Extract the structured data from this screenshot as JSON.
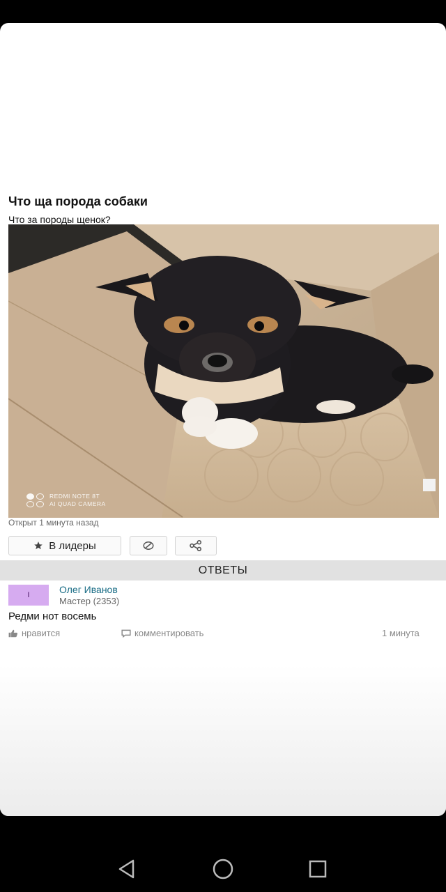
{
  "question": {
    "title": "Что ща порода собаки",
    "subtitle": "Что за породы щенок?",
    "photo_watermark": {
      "line1": "REDMI NOTE 8T",
      "line2": "AI QUAD CAMERA"
    },
    "meta": "Открыт 1 минута назад"
  },
  "actions": {
    "leaders_label": "В лидеры",
    "leaders_icon": "star-icon",
    "block_icon": "block-icon",
    "share_icon": "share-icon"
  },
  "answers": {
    "header": "ОТВЕТЫ",
    "items": [
      {
        "avatar_letter": "I",
        "author": "Олег Иванов",
        "rank": "Мастер (2353)",
        "text": "Редми нот восемь",
        "like_label": "нравится",
        "comment_label": "комментировать",
        "time": "1 минута"
      }
    ]
  },
  "navbar": {
    "back_icon": "back-triangle-icon",
    "home_icon": "home-circle-icon",
    "recents_icon": "recents-square-icon"
  },
  "colors": {
    "link": "#1a6d86",
    "avatar_bg": "#d6abf0",
    "answers_bar": "#e1e1e1"
  }
}
